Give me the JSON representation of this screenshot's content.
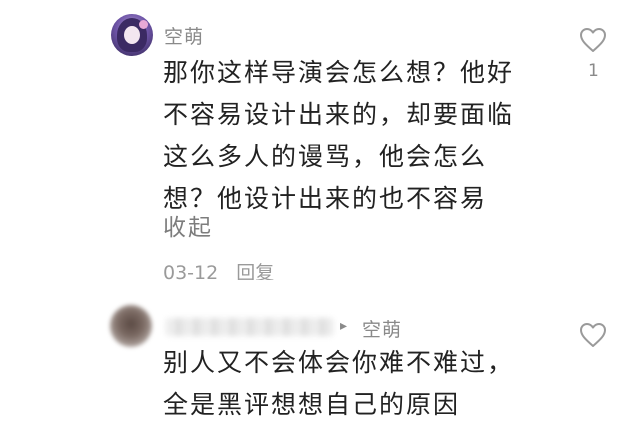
{
  "comment_main": {
    "username": "空萌",
    "lines": [
      "那你这样导演会怎么想？他好",
      "不容易设计出来的，却要面临",
      "这么多人的谩骂，他会怎么",
      "想？他设计出来的也不容易"
    ],
    "collapse_label": "收起",
    "date": "03-12",
    "reply_label": "回复",
    "like_count": "1"
  },
  "comment_reply": {
    "reply_arrow": "▸",
    "reply_to": "空萌",
    "lines": [
      "别人又不会体会你难不难过，",
      "全是黑评想想自己的原因"
    ]
  },
  "icons": {
    "heart": "heart-outline-icon"
  }
}
